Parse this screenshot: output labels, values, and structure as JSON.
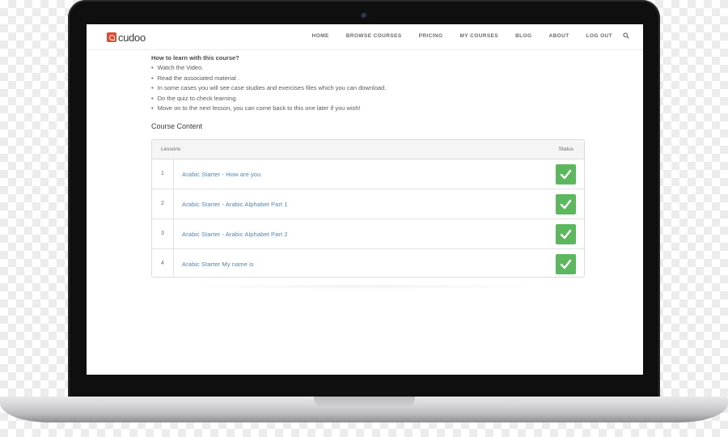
{
  "brand": {
    "name": "cudoo",
    "color": "#e2492d"
  },
  "nav": {
    "items": [
      "HOME",
      "BROWSE COURSES",
      "PRICING",
      "MY COURSES",
      "BLOG",
      "ABOUT",
      "LOG OUT"
    ],
    "search_icon": "search-icon"
  },
  "howto": {
    "title": "How to learn with this course?",
    "items": [
      "Watch the Video.",
      "Read the associated material .",
      "In some cases you will see case studies and exercises files which you can download.",
      "Do the quiz to check learning.",
      "Move on to the next lesson, you can come back to this one later if you wish!"
    ]
  },
  "course": {
    "section_title": "Course Content",
    "headers": {
      "lessons": "Lessons",
      "status": "Status"
    },
    "lessons": [
      {
        "number": "1",
        "title": "Arabic Starter - How are you",
        "status": "complete"
      },
      {
        "number": "2",
        "title": "Arabic Starter - Arabic Alphabet Part 1",
        "status": "complete"
      },
      {
        "number": "3",
        "title": "Arabic Starter - Arabic Alphabet Part 2",
        "status": "complete"
      },
      {
        "number": "4",
        "title": "Arabic Starter My name is",
        "status": "complete"
      }
    ],
    "status_color": "#5cb85c",
    "link_color": "#4a86c5"
  }
}
